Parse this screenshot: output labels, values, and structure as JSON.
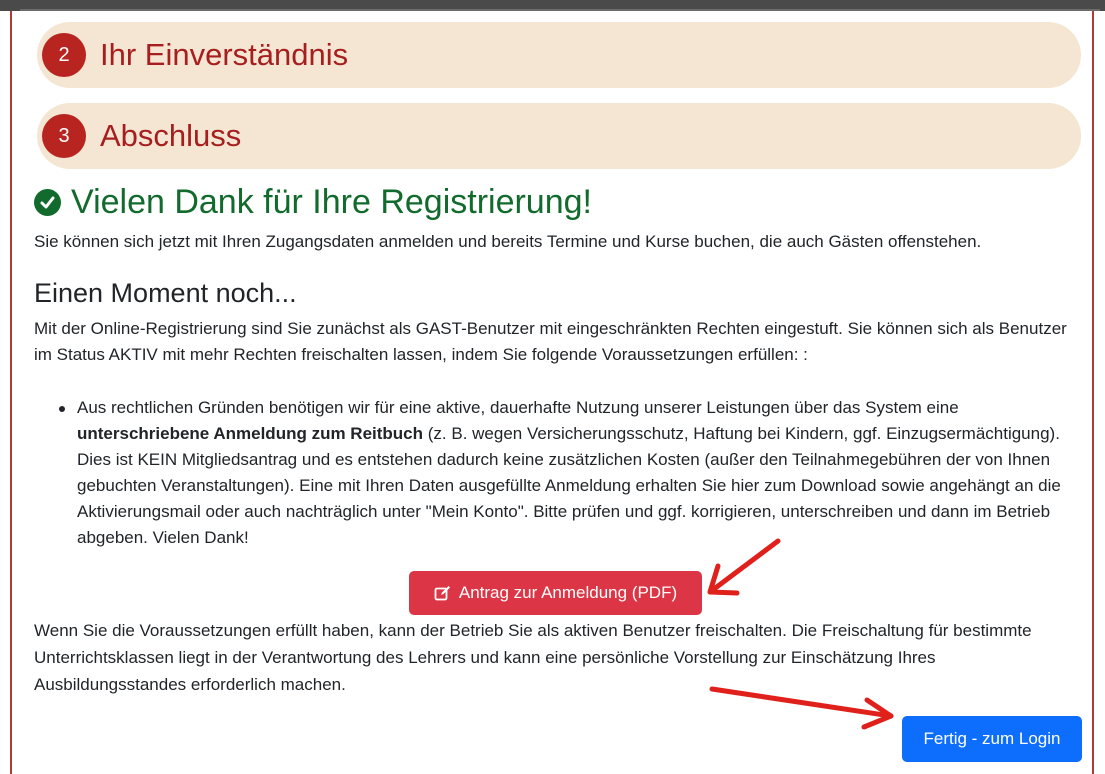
{
  "steps": [
    {
      "number": "2",
      "title": "Ihr Einverständnis"
    },
    {
      "number": "3",
      "title": "Abschluss"
    }
  ],
  "success": {
    "heading": "Vielen Dank für Ihre Registrierung!",
    "icon": "check-circle-icon",
    "color": "#126b2d"
  },
  "intro": "Sie können sich jetzt mit Ihren Zugangsdaten anmelden und bereits Termine und Kurse buchen, die auch Gästen offenstehen.",
  "moment_heading": "Einen Moment noch...",
  "para1": "Mit der Online-Registrierung sind Sie zunächst als GAST-Benutzer mit eingeschränkten Rechten eingestuft. Sie können sich als Benutzer im Status AKTIV mit mehr Rechten freischalten lassen, indem Sie folgende Voraussetzungen erfüllen: :",
  "bullet": {
    "before": "Aus rechtlichen Gründen benötigen wir für eine aktive, dauerhafte Nutzung unserer Leistungen über das System eine ",
    "bold": "unterschriebene Anmeldung zum Reitbuch",
    "after": " (z. B. wegen Versicherungsschutz, Haftung bei Kindern, ggf. Einzugsermächtigung). Dies ist KEIN Mitgliedsantrag und es entstehen dadurch keine zusätzlichen Kosten (außer den Teilnahmegebühren der von Ihnen gebuchten Veranstaltungen). Eine mit Ihren Daten ausgefüllte Anmeldung erhalten Sie hier zum Download sowie angehängt an die Aktivierungsmail oder auch nachträglich unter \"Mein Konto\". Bitte prüfen und ggf. korrigieren, unterschreiben und dann im Betrieb abgeben. Vielen Dank!"
  },
  "pdf_button": {
    "label": "Antrag zur Anmeldung (PDF)",
    "icon": "edit-icon",
    "color": "#dc3545"
  },
  "para2": "Wenn Sie die Voraussetzungen erfüllt haben, kann der Betrieb Sie als aktiven Benutzer freischalten. Die Freischaltung für bestimmte Unterrichtsklassen liegt in der Verantwortung des Lehrers und kann eine persönliche Vorstellung zur Einschätzung Ihres Ausbildungsstandes erforderlich machen.",
  "login_button": {
    "label": "Fertig - zum Login",
    "color": "#0d6efd"
  },
  "colors": {
    "step_bg": "#f5e6d3",
    "step_badge": "#b8241f",
    "step_title": "#a61e1e",
    "annotation_arrow": "#e0201b"
  }
}
